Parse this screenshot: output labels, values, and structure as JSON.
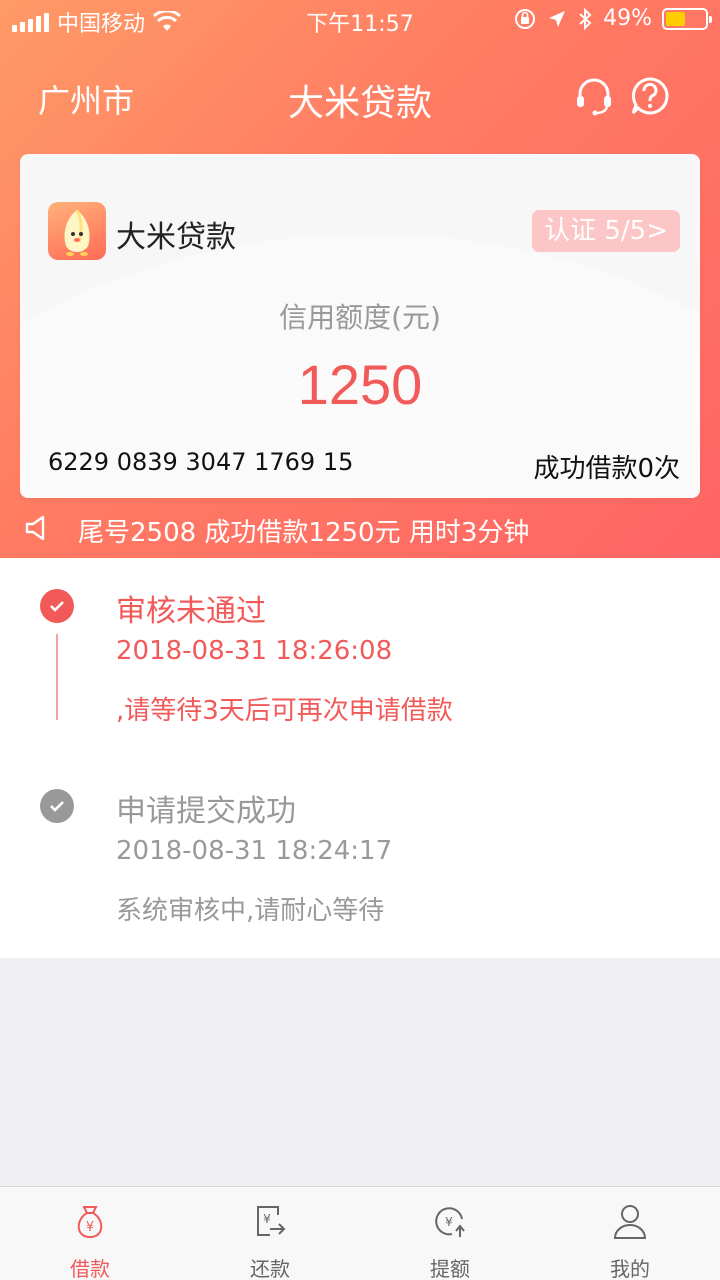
{
  "status_bar": {
    "carrier": "中国移动",
    "time": "下午11:57",
    "battery_percent": "49%",
    "battery_level": 0.49,
    "icons": [
      "signal-icon",
      "wifi-icon",
      "orientation-lock-icon",
      "location-icon",
      "bluetooth-icon",
      "battery-icon"
    ]
  },
  "nav": {
    "city": "广州市",
    "title": "大米贷款",
    "icons": [
      "headset-icon",
      "help-icon"
    ]
  },
  "card": {
    "app_name": "大米贷款",
    "auth_badge": "认证 5/5>",
    "limit_label": "信用额度(元)",
    "limit_value": "1250",
    "card_number": "6229 0839 3047 1769 15",
    "success_count": "成功借款0次"
  },
  "notice": {
    "text": "尾号2508 成功借款1250元 用时3分钟"
  },
  "timeline": [
    {
      "title": "审核未通过",
      "time": "2018-08-31 18:26:08",
      "desc": ",请等待3天后可再次申请借款"
    },
    {
      "title": "申请提交成功",
      "time": "2018-08-31 18:24:17",
      "desc": "系统审核中,请耐心等待"
    }
  ],
  "tabs": [
    {
      "label": "借款",
      "icon": "money-bag-icon"
    },
    {
      "label": "还款",
      "icon": "repay-icon"
    },
    {
      "label": "提额",
      "icon": "raise-limit-icon"
    },
    {
      "label": "我的",
      "icon": "user-icon"
    }
  ],
  "colors": {
    "accent": "#f25a5a",
    "header_start": "#ff9a66",
    "header_end": "#ff6565",
    "inactive": "#999999",
    "tab_inactive": "#666666"
  }
}
